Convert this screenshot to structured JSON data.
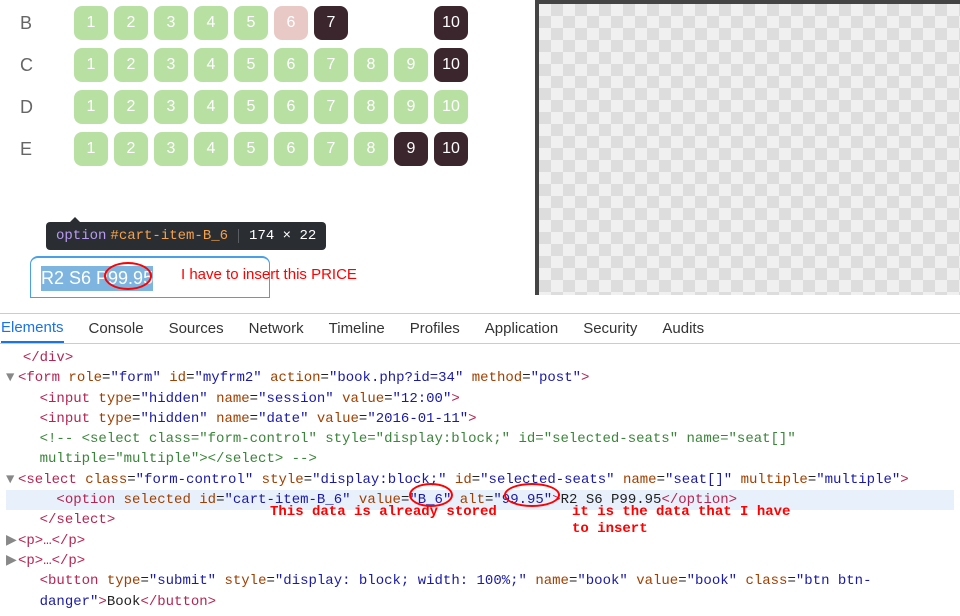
{
  "rows": [
    {
      "label": "B",
      "seats": [
        {
          "n": "1",
          "s": "avail"
        },
        {
          "n": "2",
          "s": "avail"
        },
        {
          "n": "3",
          "s": "avail"
        },
        {
          "n": "4",
          "s": "avail"
        },
        {
          "n": "5",
          "s": "avail"
        },
        {
          "n": "6",
          "s": "sel"
        },
        {
          "n": "7",
          "s": "taken"
        },
        {
          "n": "",
          "s": "hidden"
        },
        {
          "n": "",
          "s": "hidden"
        },
        {
          "n": "10",
          "s": "taken"
        }
      ]
    },
    {
      "label": "C",
      "seats": [
        {
          "n": "1",
          "s": "avail"
        },
        {
          "n": "2",
          "s": "avail"
        },
        {
          "n": "3",
          "s": "avail"
        },
        {
          "n": "4",
          "s": "avail"
        },
        {
          "n": "5",
          "s": "avail"
        },
        {
          "n": "6",
          "s": "avail"
        },
        {
          "n": "7",
          "s": "avail"
        },
        {
          "n": "8",
          "s": "avail"
        },
        {
          "n": "9",
          "s": "avail"
        },
        {
          "n": "10",
          "s": "taken"
        }
      ]
    },
    {
      "label": "D",
      "seats": [
        {
          "n": "1",
          "s": "avail"
        },
        {
          "n": "2",
          "s": "avail"
        },
        {
          "n": "3",
          "s": "avail"
        },
        {
          "n": "4",
          "s": "avail"
        },
        {
          "n": "5",
          "s": "avail"
        },
        {
          "n": "6",
          "s": "avail"
        },
        {
          "n": "7",
          "s": "avail"
        },
        {
          "n": "8",
          "s": "avail"
        },
        {
          "n": "9",
          "s": "avail"
        },
        {
          "n": "10",
          "s": "avail"
        }
      ]
    },
    {
      "label": "E",
      "seats": [
        {
          "n": "1",
          "s": "avail"
        },
        {
          "n": "2",
          "s": "avail"
        },
        {
          "n": "3",
          "s": "avail"
        },
        {
          "n": "4",
          "s": "avail"
        },
        {
          "n": "5",
          "s": "avail"
        },
        {
          "n": "6",
          "s": "avail"
        },
        {
          "n": "7",
          "s": "avail"
        },
        {
          "n": "8",
          "s": "avail"
        },
        {
          "n": "9",
          "s": "taken"
        },
        {
          "n": "10",
          "s": "taken"
        }
      ]
    }
  ],
  "tooltip": {
    "tag": "option",
    "selector": "#cart-item-B_6",
    "dim": "174 × 22"
  },
  "option_text": "R2 S6 P99.95",
  "annotations": {
    "insert_price": "I have to insert this PRICE",
    "already_stored": "This data is already stored",
    "data_insert": "it is the data that I have",
    "data_insert2": "to insert"
  },
  "tabs": [
    "Elements",
    "Console",
    "Sources",
    "Network",
    "Timeline",
    "Profiles",
    "Application",
    "Security",
    "Audits"
  ],
  "code": {
    "l0": "</div>",
    "l1a": "<form ",
    "l1b": "role",
    "l1c": "\"form\"",
    "l1d": "id",
    "l1e": "\"myfrm2\"",
    "l1f": "action",
    "l1g": "\"book.php?id=34\"",
    "l1h": "method",
    "l1i": "\"post\"",
    "l1j": ">",
    "l2a": "<input ",
    "l2b": "type",
    "l2c": "\"hidden\"",
    "l2d": "name",
    "l2e": "\"session\"",
    "l2f": "value",
    "l2g": "\"12:00\"",
    "l2h": ">",
    "l3a": "<input ",
    "l3b": "type",
    "l3c": "\"hidden\"",
    "l3d": "name",
    "l3e": "\"date\"",
    "l3f": "value",
    "l3g": "\"2016-01-11\"",
    "l3h": ">",
    "l4a": "<!--        <select class=\"form-control\" style=\"display:block;\" id=\"selected-seats\" name=\"seat[]\"",
    "l4b": "multiple=\"multiple\"></select>       -->",
    "l5a": "<select ",
    "l5b": "class",
    "l5c": "\"form-control\"",
    "l5d": "style",
    "l5e": "\"display:block;\"",
    "l5f": "id",
    "l5g": "\"selected-seats\"",
    "l5h": "name",
    "l5i": "\"seat[]\"",
    "l5j": "multiple",
    "l5k": "\"multiple\"",
    "l5l": ">",
    "l6a": "<option ",
    "l6b": "selected",
    "l6c": "id",
    "l6d": "\"cart-item-B_6\"",
    "l6e": "value",
    "l6f": "\"B_6\"",
    "l6g": "alt",
    "l6h": "\"99.95\"",
    "l6i": ">",
    "l6j": "R2 S6 P99.95",
    "l6k": "</option>",
    "l7": "</select>",
    "l8": "<p>…</p>",
    "l9": "<p>…</p>",
    "l10a": "<button ",
    "l10b": "type",
    "l10c": "\"submit\"",
    "l10d": "style",
    "l10e": "\"display: block; width: 100%;\"",
    "l10f": "name",
    "l10g": "\"book\"",
    "l10h": "value",
    "l10i": "\"book\"",
    "l10j": "class",
    "l10k": "\"btn btn-",
    "l10l": "danger\"",
    "l10m": ">",
    "l10n": "Book",
    "l10o": "</button>"
  }
}
